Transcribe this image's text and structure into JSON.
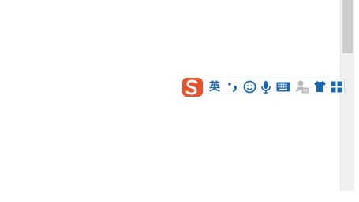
{
  "ime_toolbar": {
    "logo": {
      "icon": "sogou-logo-icon",
      "letter": "S",
      "color": "#e8512a"
    },
    "language_label": "英",
    "items": [
      {
        "name": "punctuation-icon"
      },
      {
        "name": "emoji-icon"
      },
      {
        "name": "microphone-icon"
      },
      {
        "name": "keyboard-icon"
      },
      {
        "name": "user-account-icon"
      },
      {
        "name": "skin-icon"
      },
      {
        "name": "toolbox-icon"
      }
    ],
    "accent_color": "#1a67b4"
  },
  "scrollbar": {
    "orientation": "vertical"
  }
}
